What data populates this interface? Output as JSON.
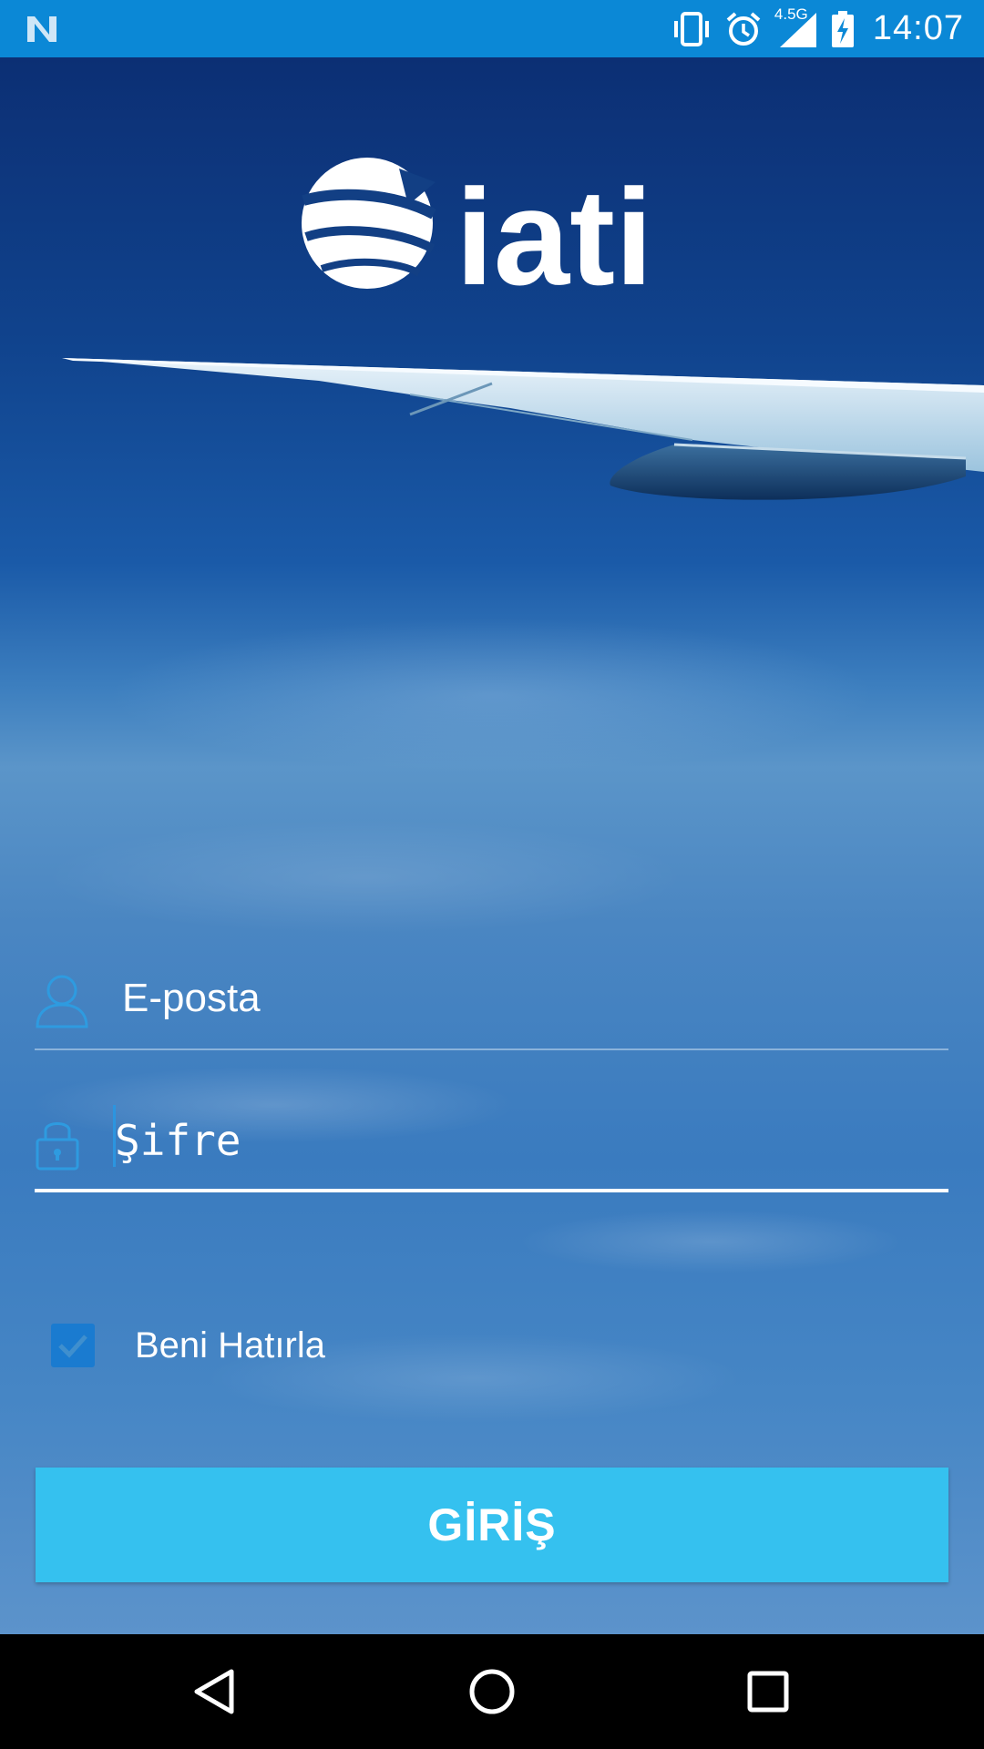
{
  "status_bar": {
    "time": "14:07",
    "network_type": "4.5G",
    "background_color": "#0b88d6",
    "icons": [
      "notification-n-icon",
      "vibrate-icon",
      "alarm-icon",
      "signal-icon",
      "battery-charging-icon"
    ]
  },
  "logo": {
    "text": "iati"
  },
  "login_form": {
    "email_placeholder": "E-posta",
    "password_placeholder": "Şifre",
    "remember_label": "Beni Hatırla",
    "remember_checked": true,
    "submit_label": "GİRİŞ",
    "button_color": "#35c1ef",
    "icon_color": "#2e9be0"
  },
  "nav_bar": {
    "icons": [
      "back-icon",
      "home-icon",
      "recents-icon"
    ]
  }
}
